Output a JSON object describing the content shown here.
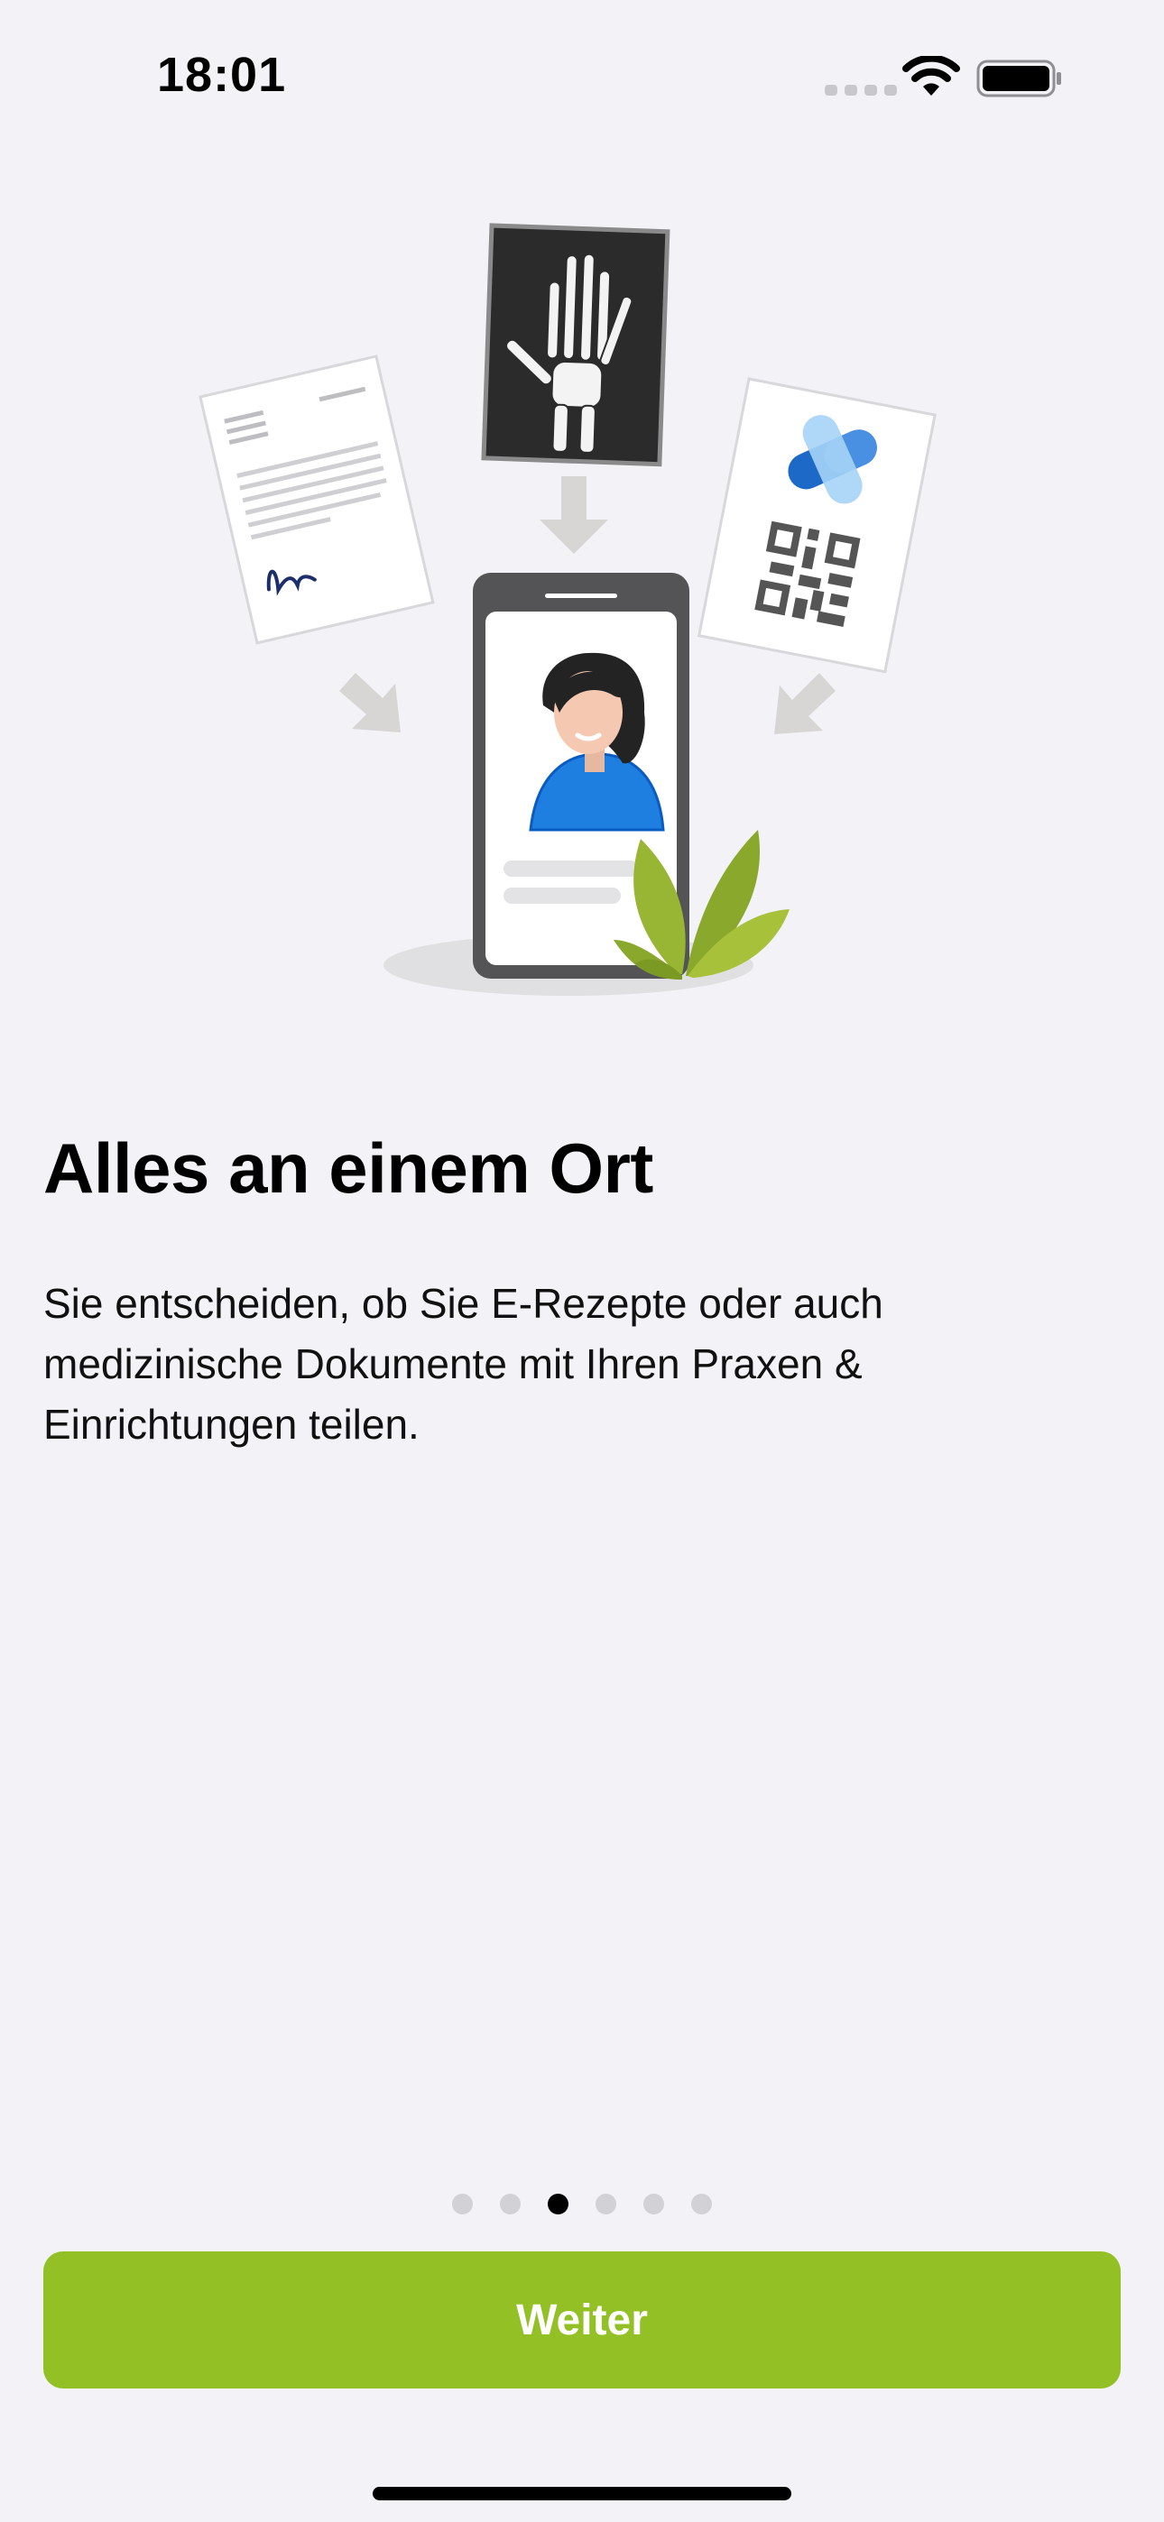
{
  "status_bar": {
    "time": "18:01",
    "wifi_icon": "wifi-icon",
    "battery_icon": "battery-icon"
  },
  "onboarding": {
    "title": "Alles an einem Ort",
    "description": "Sie entscheiden, ob Sie E-Rezepte oder auch medizinische Dokumente mit Ihren Praxen & Einrichtungen teilen.",
    "illustration_icon": "documents-to-phone-illustration",
    "page_indicator": {
      "total": 6,
      "current": 3
    },
    "next_button_label": "Weiter"
  },
  "colors": {
    "background": "#f2f2f7",
    "accent": "#93c024",
    "text": "#000000"
  }
}
